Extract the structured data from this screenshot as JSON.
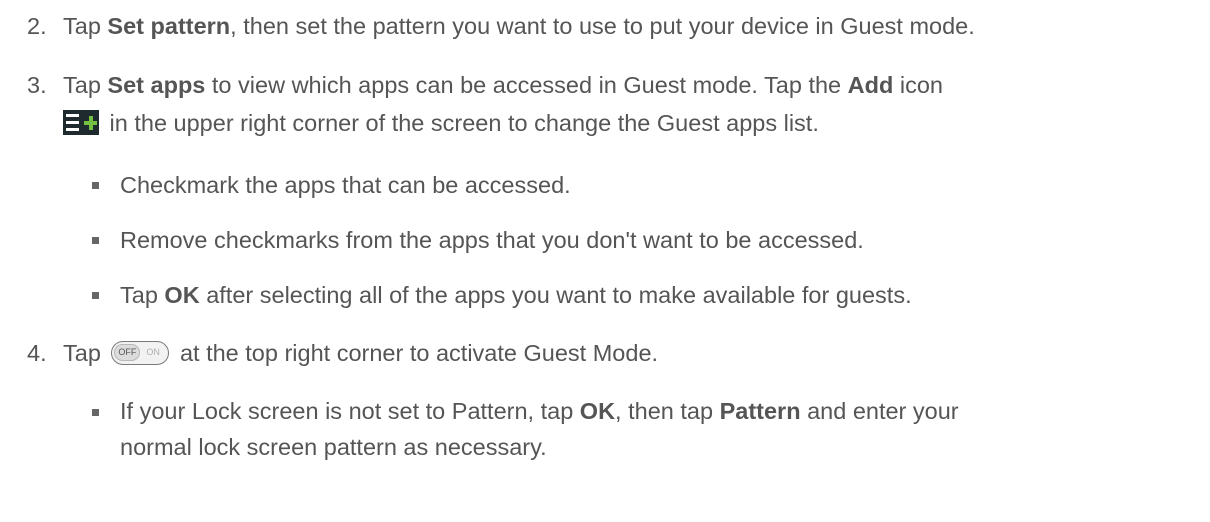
{
  "steps": [
    {
      "number": "2.",
      "tap": "Tap ",
      "action": "Set pattern",
      "rest": ", then set the pattern you want to use to put your device in Guest mode."
    },
    {
      "number": "3.",
      "tap": "Tap ",
      "action": "Set apps",
      "mid": " to view which apps can be accessed in Guest mode. Tap the ",
      "add_label": "Add",
      "icon_word": " icon",
      "line2": " in the upper right corner of the screen to change the Guest apps list.",
      "icon": "add-list-icon",
      "bullets": [
        {
          "text": "Checkmark the apps that can be accessed."
        },
        {
          "text": "Remove checkmarks from the apps that you don't want to be accessed."
        },
        {
          "pre": "Tap ",
          "bold": "OK",
          "post": " after selecting all of the apps you want to make available for guests."
        }
      ]
    },
    {
      "number": "4.",
      "tap": "Tap ",
      "rest": " at the top right corner to activate Guest Mode.",
      "toggle": {
        "off_label": "OFF",
        "on_label": "ON",
        "icon": "off-on-toggle-icon"
      },
      "bullets": [
        {
          "pre": "If your Lock screen is not set to Pattern, tap ",
          "bold1": "OK",
          "mid": ", then tap ",
          "bold2": "Pattern",
          "post": " and enter your",
          "line2": "normal lock screen pattern as necessary."
        }
      ]
    }
  ],
  "colors": {
    "text": "#555555",
    "bullet": "#666666",
    "icon_bg": "#1e2a2e",
    "icon_accent": "#74c043"
  }
}
